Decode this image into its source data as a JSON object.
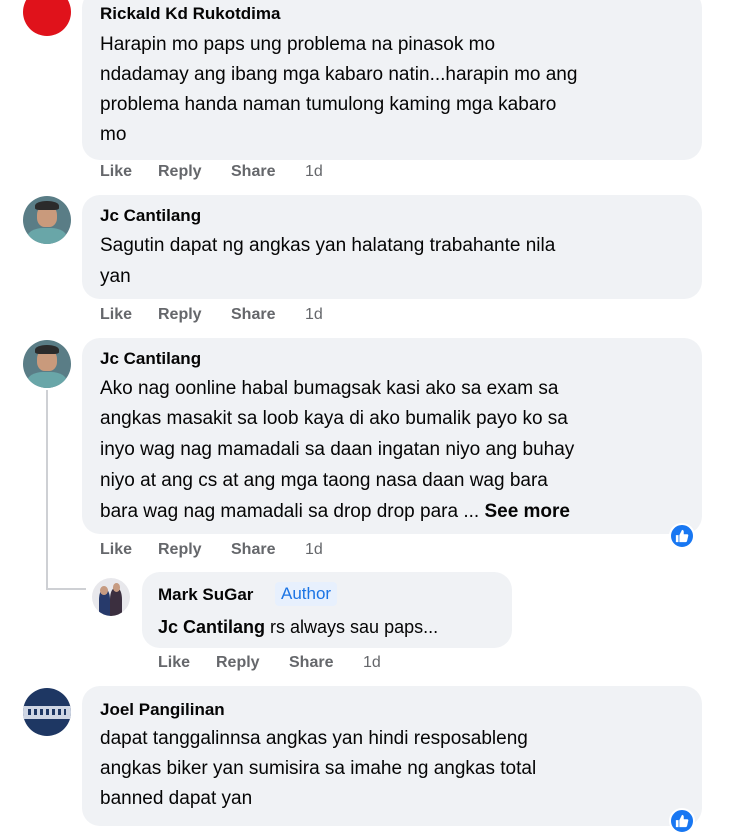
{
  "comments": [
    {
      "author": "Rickald Kd Rukotdima",
      "lines": [
        "Harapin mo paps ung problema na pinasok mo",
        "ndadamay ang ibang mga kabaro natin...harapin mo ang",
        "problema handa naman tumulong kaming mga kabaro",
        "mo"
      ],
      "actions": {
        "like": "Like",
        "reply": "Reply",
        "share": "Share",
        "time": "1d"
      }
    },
    {
      "author": "Jc Cantilang",
      "lines": [
        "Sagutin dapat ng angkas yan halatang trabahante nila",
        "yan"
      ],
      "actions": {
        "like": "Like",
        "reply": "Reply",
        "share": "Share",
        "time": "1d"
      }
    },
    {
      "author": "Jc Cantilang",
      "lines": [
        "Ako nag oonline habal bumagsak kasi ako sa exam sa",
        "angkas masakit sa loob kaya di ako bumalik payo ko sa",
        "inyo wag nag mamadali sa daan ingatan niyo ang buhay",
        "niyo at ang cs at ang mga taong nasa daan wag bara",
        "bara wag nag mamadali sa drop drop para ..."
      ],
      "see_more": "See more",
      "actions": {
        "like": "Like",
        "reply": "Reply",
        "share": "Share",
        "time": "1d"
      }
    }
  ],
  "reply": {
    "author": "Mark SuGar",
    "badge": "Author",
    "tag": "Jc Cantilang",
    "text": " rs always sau paps...",
    "actions": {
      "like": "Like",
      "reply": "Reply",
      "share": "Share",
      "time": "1d"
    }
  },
  "last_comment": {
    "author": "Joel Pangilinan",
    "lines": [
      "dapat tanggalinnsa angkas yan hindi resposableng",
      "angkas biker yan sumisira sa imahe ng angkas total",
      "banned dapat yan"
    ]
  },
  "colors": {
    "bubble_bg": "#f0f2f5",
    "secondary_text": "#65676b",
    "badge_bg": "#e7f0fd",
    "badge_text": "#1b74e4",
    "reaction_blue": "#1877f2"
  },
  "icons": {
    "reaction": "like-reaction-icon"
  }
}
